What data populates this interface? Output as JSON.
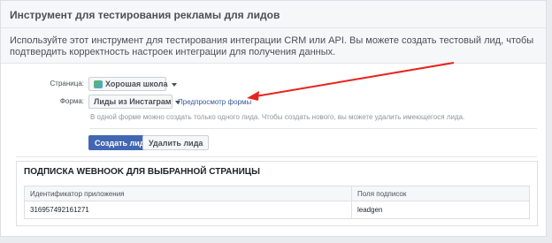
{
  "header": {
    "title": "Инструмент для тестирования рекламы для лидов"
  },
  "intro": {
    "text": "Используйте этот инструмент для тестирования интеграции CRM или API. Вы можете создать тестовый лид, чтобы подтвердить корректность настроек интеграции для получения данных."
  },
  "form": {
    "page_label": "Страница:",
    "page_value": "Хорошая школа",
    "form_label": "Форма:",
    "form_value": "Лиды из Инстаграм",
    "preview_link": "Предпросмотр формы",
    "hint": "В одной форме можно создать только одного лида. Чтобы создать нового, вы можете удалить имеющегося лида."
  },
  "actions": {
    "create": "Создать лид",
    "delete": "Удалить лида"
  },
  "webhook": {
    "title": "ПОДПИСКА WEBHOOK ДЛЯ ВЫБРАННОЙ СТРАНИЦЫ",
    "columns": [
      "Идентификатор приложения",
      "Поля подписок"
    ],
    "rows": [
      [
        "316957492161271",
        "leadgen"
      ]
    ]
  },
  "colors": {
    "accent": "#4267b2",
    "annotation_arrow": "#e8231e",
    "link": "#365899"
  }
}
